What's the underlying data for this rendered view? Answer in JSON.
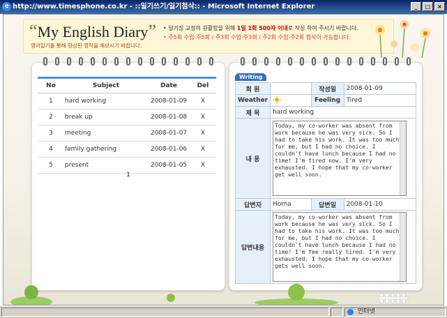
{
  "window": {
    "title": "http://www.timesphone.co.kr - ::일기쓰기/일기첨삭:: - Microsoft Internet Explorer"
  },
  "header": {
    "logo_text": "My English Diary",
    "subtitle": "영어일기를 통해 향상된 영작을 해보시기 바랍니다.",
    "notice1_pre": "• 일기장 교정의 원활함을 위해 ",
    "notice1_em": "1일 1회 500자 이내",
    "notice1_post": "로 작성 하여 주시기 바랍니다.",
    "notice2": "• 주5회 수업-주5회 / 주3회 수업-주3회 / 주2회 수업-주2회 첨삭이 가능합니다."
  },
  "list": {
    "headers": {
      "no": "No",
      "subject": "Subject",
      "date": "Date",
      "del": "Del"
    },
    "rows": [
      {
        "no": "1",
        "subject": "hard working",
        "date": "2008-01-09",
        "del": "X"
      },
      {
        "no": "2",
        "subject": "break up",
        "date": "2008-01-08",
        "del": "X"
      },
      {
        "no": "3",
        "subject": "meeting",
        "date": "2008-01-07",
        "del": "X"
      },
      {
        "no": "4",
        "subject": "family gathering",
        "date": "2008-01-06",
        "del": "X"
      },
      {
        "no": "5",
        "subject": "present",
        "date": "2008-01-05",
        "del": "X"
      }
    ],
    "page": "1"
  },
  "writing": {
    "tab": "Writing",
    "member_label": "회 원",
    "member_value": "",
    "written_date_label": "작성일",
    "written_date": "2008-01-09",
    "weather_label": "Weather",
    "weather_icon": "sun-icon",
    "feeling_label": "Feeling",
    "feeling": "Tired",
    "title_label": "제 목",
    "title_value": "hard working",
    "content_label": "내 용",
    "content": "Today, my co-worker was absent from work because he was very sick. So I had to take his work. It was too much for me, but I had no choice. I couldn't have lunch because I had no time! I'm tired now. I'm very exhausted. I hope that my co-worker get well soon.",
    "answerer_label": "답변자",
    "answerer": "Homa",
    "answer_date_label": "답변일",
    "answer_date": "2008-01-10",
    "answer_label": "답변내용",
    "answer": "Today, my co-worker was absent from work because he was very sick. So I had to take his work. It was too much for me, but I had no choice. I couldn't have lunch because I had no time! I'm fee really tired. I'm very exhausted. I hope that my co-worker gets well soon."
  },
  "statusbar": {
    "zone": "인터넷"
  }
}
